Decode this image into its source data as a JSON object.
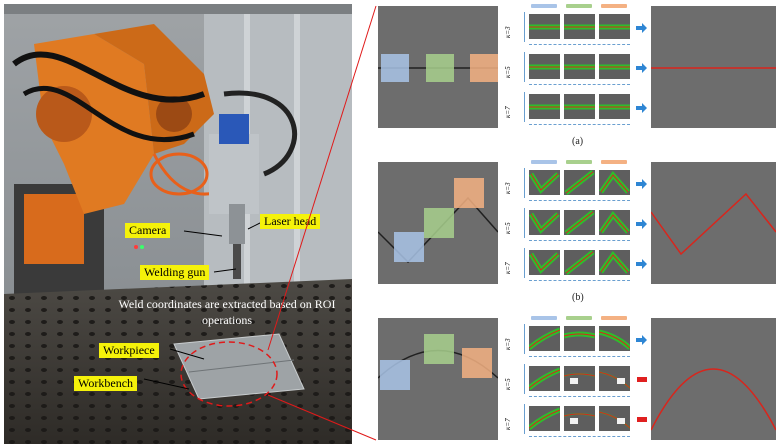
{
  "photo": {
    "labels": {
      "camera": "Camera",
      "laser_head": "Laser head",
      "welding_gun": "Welding gun",
      "workpiece": "Workpiece",
      "workbench": "Workbench"
    },
    "annotation": "Weld coordinates are extracted based on ROI operations"
  },
  "panels": [
    {
      "caption": "(a)",
      "shape": "line",
      "k_labels": [
        "κ=3",
        "κ=5",
        "κ=7"
      ],
      "status": [
        "pass",
        "pass",
        "pass"
      ]
    },
    {
      "caption": "(b)",
      "shape": "zigzag",
      "k_labels": [
        "κ=3",
        "κ=5",
        "κ=7"
      ],
      "status": [
        "pass",
        "pass",
        "pass"
      ]
    },
    {
      "caption": "",
      "shape": "arc",
      "k_labels": [
        "κ=3",
        "κ=5",
        "κ=7"
      ],
      "status": [
        "pass",
        "fail",
        "fail"
      ]
    }
  ],
  "colors": {
    "roi_blue": "#a9c4e8",
    "roi_green": "#a8d08d",
    "roi_orange": "#f4b183",
    "weld_line": "#d9251c",
    "detect_green": "#28c828",
    "arrow_blue": "#2e86d4",
    "fail_red": "#e02020",
    "label_yellow": "#f5f20a"
  }
}
